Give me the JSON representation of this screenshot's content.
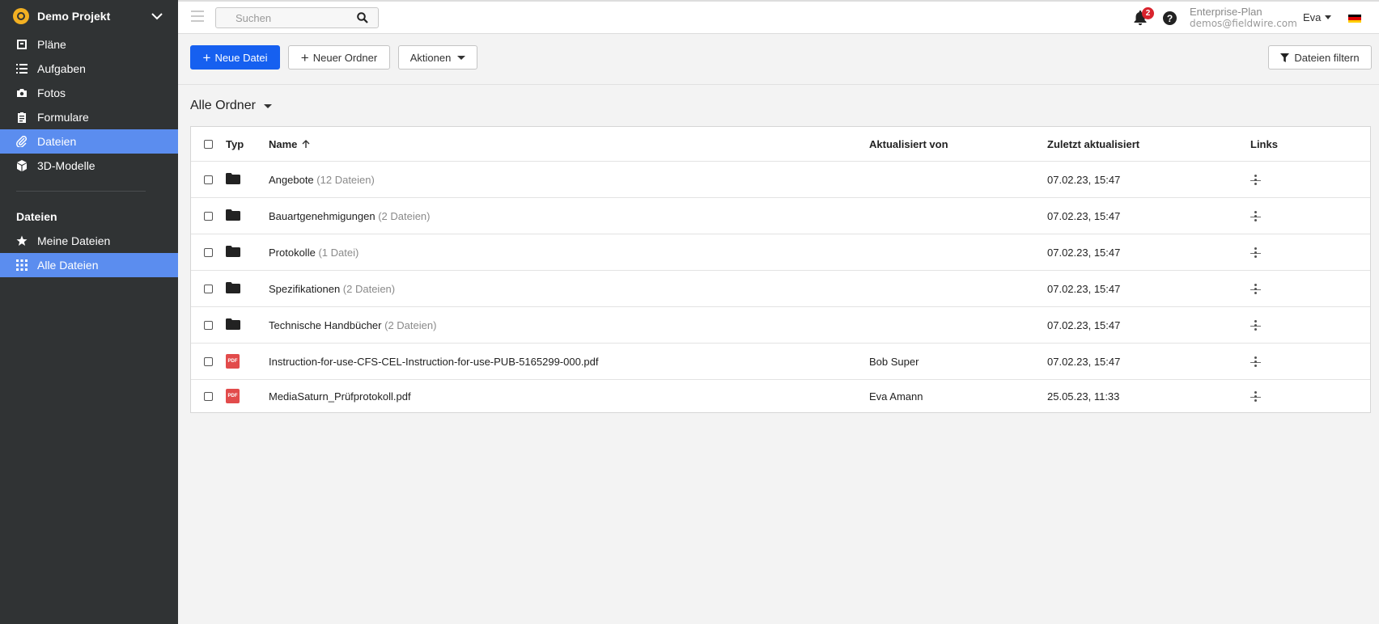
{
  "sidebar": {
    "project_title": "Demo Projekt",
    "nav": [
      {
        "label": "Pläne",
        "icon": "plans-icon"
      },
      {
        "label": "Aufgaben",
        "icon": "list-icon"
      },
      {
        "label": "Fotos",
        "icon": "camera-icon"
      },
      {
        "label": "Formulare",
        "icon": "clipboard-icon"
      },
      {
        "label": "Dateien",
        "icon": "paperclip-icon",
        "active": true
      },
      {
        "label": "3D-Modelle",
        "icon": "cube-icon"
      }
    ],
    "section_title": "Dateien",
    "sub_nav": [
      {
        "label": "Meine Dateien",
        "icon": "star-icon"
      },
      {
        "label": "Alle Dateien",
        "icon": "grid-icon",
        "active": true
      }
    ]
  },
  "topbar": {
    "search_placeholder": "Suchen",
    "notification_count": "2",
    "help_glyph": "?",
    "plan_name": "Enterprise-Plan",
    "plan_email": "demos@fieldwire.com",
    "user_name": "Eva"
  },
  "toolbar": {
    "new_file": "Neue Datei",
    "new_folder": "Neuer Ordner",
    "actions": "Aktionen",
    "filter": "Dateien filtern"
  },
  "folder_selector": "Alle Ordner",
  "table": {
    "headers": {
      "type": "Typ",
      "name": "Name",
      "updated_by": "Aktualisiert von",
      "last_updated": "Zuletzt aktualisiert",
      "links": "Links"
    },
    "rows": [
      {
        "type": "folder",
        "name": "Angebote",
        "count": "(12 Dateien)",
        "updated_by": "",
        "date": "07.02.23, 15:47",
        "links": "—"
      },
      {
        "type": "folder",
        "name": "Bauartgenehmigungen",
        "count": "(2 Dateien)",
        "updated_by": "",
        "date": "07.02.23, 15:47",
        "links": "—"
      },
      {
        "type": "folder",
        "name": "Protokolle",
        "count": "(1 Datei)",
        "updated_by": "",
        "date": "07.02.23, 15:47",
        "links": "—"
      },
      {
        "type": "folder",
        "name": "Spezifikationen",
        "count": "(2 Dateien)",
        "updated_by": "",
        "date": "07.02.23, 15:47",
        "links": "—"
      },
      {
        "type": "folder",
        "name": "Technische Handbücher",
        "count": "(2 Dateien)",
        "updated_by": "",
        "date": "07.02.23, 15:47",
        "links": "—"
      },
      {
        "type": "pdf",
        "pdf_label": "PDF",
        "name": "Instruction-for-use-CFS-CEL-Instruction-for-use-PUB-5165299-000.pdf",
        "count": "",
        "updated_by": "Bob Super",
        "date": "07.02.23, 15:47",
        "links": "—"
      },
      {
        "type": "pdf",
        "pdf_label": "PDF",
        "name": "MediaSaturn_Prüfprotokoll.pdf",
        "count": "",
        "updated_by": "Eva Amann",
        "date": "25.05.23, 11:33",
        "links": "—"
      }
    ]
  },
  "colors": {
    "sidebar_bg": "#303334",
    "active_nav": "#5b8def",
    "primary_button": "#1660f0",
    "badge": "#d9232d",
    "pdf_icon": "#e24b4b"
  }
}
